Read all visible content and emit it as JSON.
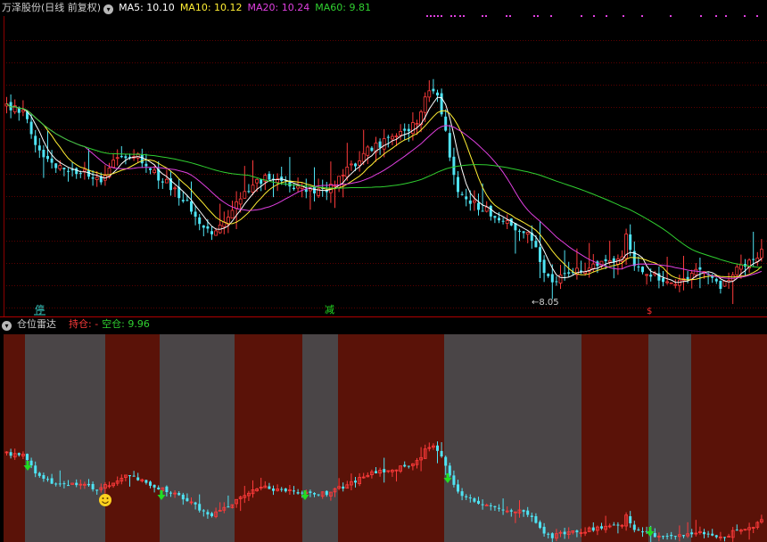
{
  "main_header": {
    "stock_label": "万泽股份(日线 前复权)",
    "ma5_label": "MA5: 10.10",
    "ma10_label": "MA10: 10.12",
    "ma20_label": "MA20: 10.24",
    "ma60_label": "MA60: 9.81"
  },
  "sub_header": {
    "title": "仓位雷达",
    "hold_label": "持仓: -",
    "empty_label": "空仓: 9.96"
  },
  "markers": {
    "stop_label": "停",
    "reduce_label": "减",
    "s_label": "$",
    "low_price_label": "←8.05"
  },
  "colors": {
    "background": "#000000",
    "up_candle": "#ff3b3b",
    "down_candle": "#4fe3f3",
    "ma5": "#ffffff",
    "ma10": "#ffee33",
    "ma20": "#e040e0",
    "ma60": "#30d030",
    "hold_zone": "#5a1208",
    "empty_zone": "#4a4547",
    "arrow": "#22dd22",
    "grid": "#7a0000"
  },
  "chart_data": [
    {
      "type": "candlestick",
      "title": "万泽股份(日线 前复权)",
      "series": [
        {
          "name": "MA5",
          "last": 10.1
        },
        {
          "name": "MA10",
          "last": 10.12
        },
        {
          "name": "MA20",
          "last": 10.24
        },
        {
          "name": "MA60",
          "last": 9.81
        }
      ],
      "annotations": [
        "停",
        "减",
        "$",
        "←8.05"
      ],
      "grid": true
    },
    {
      "type": "area",
      "title": "仓位雷达",
      "series": [
        {
          "name": "持仓",
          "value": "-"
        },
        {
          "name": "空仓",
          "value": 9.96
        }
      ],
      "zones": [
        "hold",
        "empty",
        "hold",
        "empty",
        "hold",
        "empty",
        "hold",
        "empty",
        "hold",
        "empty",
        "hold"
      ]
    }
  ]
}
